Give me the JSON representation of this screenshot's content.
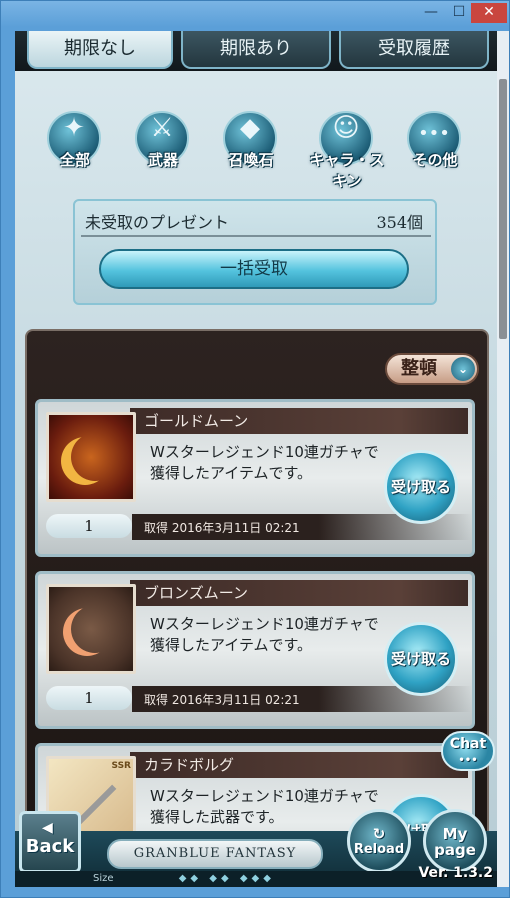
{
  "window": {
    "minimize": "—",
    "maximize": "☐",
    "close": "✕"
  },
  "tabs": [
    {
      "label": "期限なし"
    },
    {
      "label": "期限あり"
    },
    {
      "label": "受取履歴"
    }
  ],
  "categories": [
    {
      "label": "全部",
      "icon": "all-items-icon",
      "glyph": "✦"
    },
    {
      "label": "武器",
      "icon": "sword-icon",
      "glyph": "⚔"
    },
    {
      "label": "召喚石",
      "icon": "crystal-icon",
      "glyph": "◆"
    },
    {
      "label": "キャラ・スキン",
      "icon": "character-icon",
      "glyph": "☺"
    },
    {
      "label": "その他",
      "icon": "more-icon",
      "glyph": "•••"
    }
  ],
  "unreceived": {
    "title": "未受取のプレゼント",
    "count": "354個",
    "bulk_label": "一括受取"
  },
  "sort": {
    "label": "整頓",
    "icon": "chevron-down-icon",
    "glyph": "⌄"
  },
  "items": [
    {
      "name": "ゴールドムーン",
      "desc": "Wスターレジェンド10連ガチャで獲得したアイテムです。",
      "qty": "1",
      "acquired": "取得 2016年3月11日 02:21",
      "receive": "受け取る"
    },
    {
      "name": "ブロンズムーン",
      "desc": "Wスターレジェンド10連ガチャで獲得したアイテムです。",
      "qty": "1",
      "acquired": "取得 2016年3月11日 02:21",
      "receive": "受け取る"
    },
    {
      "name": "カラドボルグ",
      "desc": "Wスターレジェンド10連ガチャで獲得した武器です。",
      "ssr": "SSR",
      "receive": "受け取る"
    }
  ],
  "chat": {
    "label": "Chat",
    "dots": "•••"
  },
  "bottom": {
    "back": "Back",
    "back_arrow": "◀",
    "logo": "GRANBLUE FANTASY",
    "reload": "Reload",
    "reload_icon": "↻",
    "mypage_line1": "My",
    "mypage_line2": "page",
    "size": "Size",
    "dots": "◆◆ ◆◆ ◆◆◆",
    "version": "Ver. 1.3.2"
  }
}
